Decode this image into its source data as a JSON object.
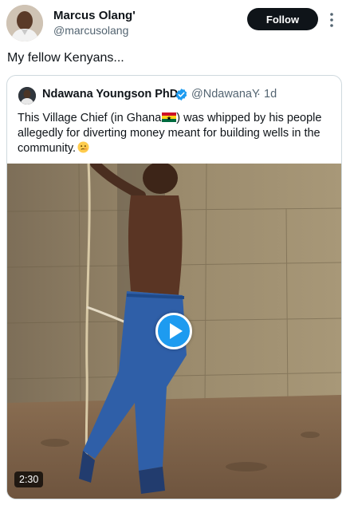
{
  "post": {
    "author_name": "Marcus Olang'",
    "author_handle": "@marcusolang",
    "follow_label": "Follow",
    "text": "My fellow Kenyans..."
  },
  "quoted": {
    "author_name": "Ndawana Youngson PhD.",
    "author_handle": "@NdawanaY",
    "separator": "·",
    "time": "1d",
    "text_before_flag": "This Village Chief (in Ghana",
    "text_after_flag": ") was whipped by his people allegedly for diverting money meant for building wells in the community.",
    "video_duration": "2:30"
  },
  "icons": {
    "more": "more-vertical-icon",
    "verified": "verified-badge-icon",
    "play": "play-icon",
    "flag": "ghana-flag-emoji",
    "emoji": "face-emoji"
  },
  "colors": {
    "follow_bg": "#0f1419",
    "verified": "#1d9bf0",
    "play": "#1d9bf0",
    "secondary_text": "#536471",
    "border": "#cfd9de"
  }
}
